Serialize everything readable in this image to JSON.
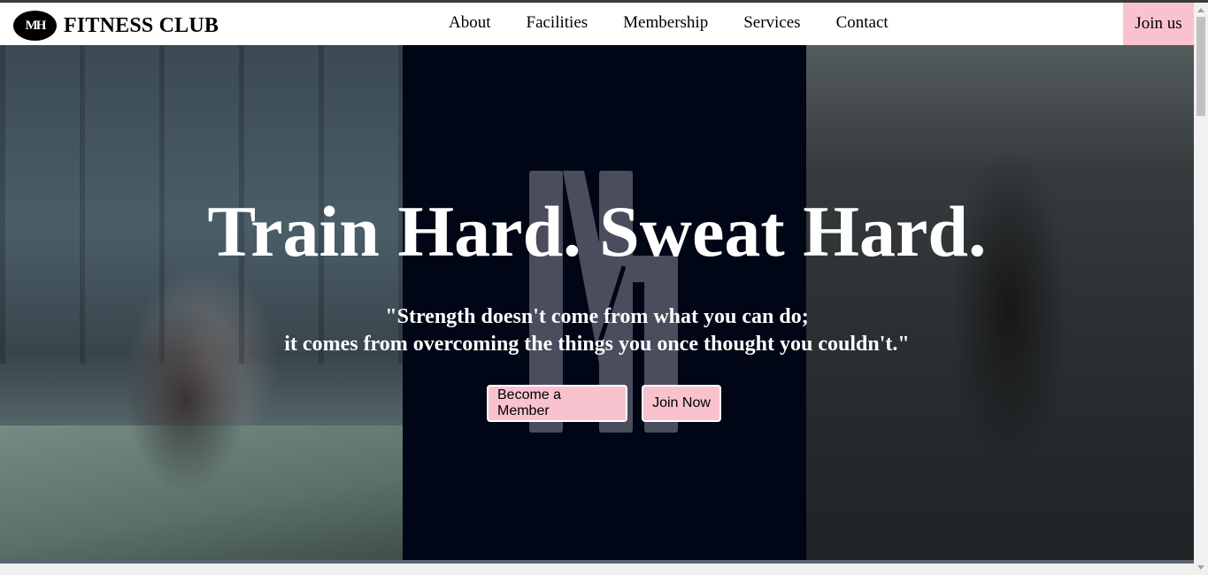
{
  "nav": {
    "brand_logo_text": "MH",
    "brand_name": "FITNESS CLUB",
    "links": [
      "About",
      "Facilities",
      "Membership",
      "Services",
      "Contact"
    ],
    "cta": "Join us"
  },
  "hero": {
    "title": "Train Hard. Sweat Hard.",
    "quote_line1": "\"Strength doesn't come from what you can do;",
    "quote_line2": "it comes from overcoming the things you once thought you couldn't.\"",
    "primary_button": "Become a Member",
    "secondary_button": "Join Now",
    "panel_logo_text": "MH"
  },
  "colors": {
    "accent_pink": "#f9c2cf",
    "panel_dark": "#000615"
  }
}
